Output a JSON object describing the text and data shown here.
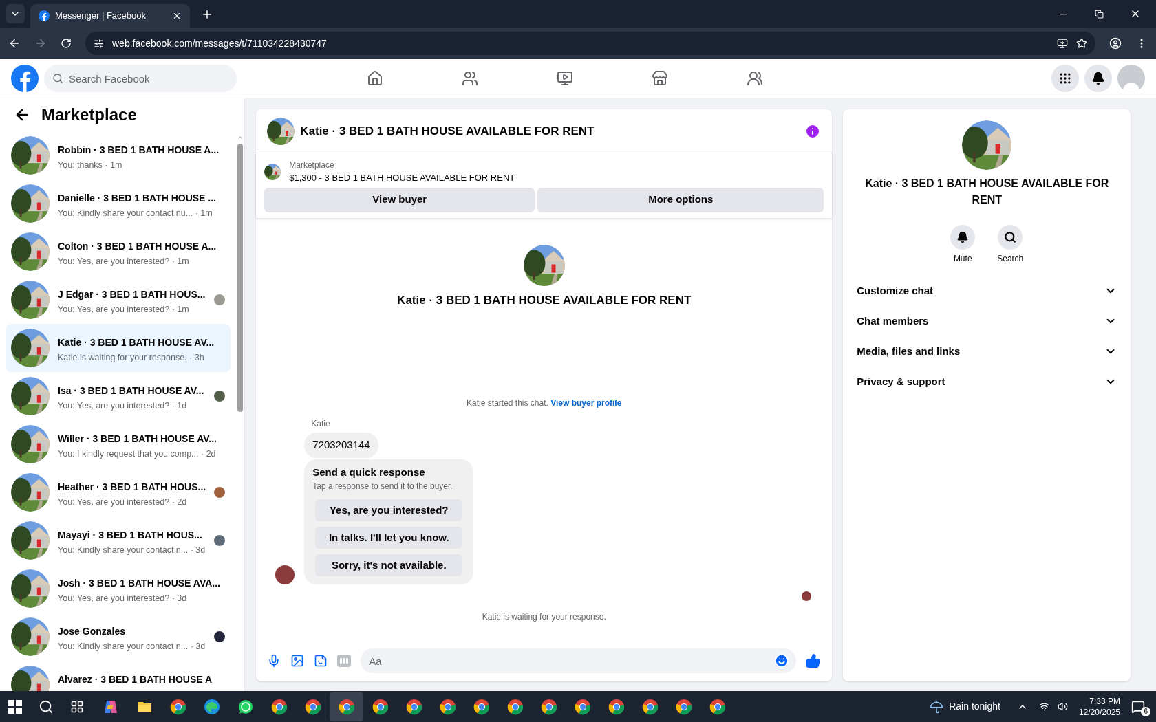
{
  "browser": {
    "tab_title": "Messenger | Facebook",
    "url": "web.facebook.com/messages/t/711034228430747"
  },
  "topbar": {
    "search_placeholder": "Search Facebook",
    "nav": [
      {
        "kind": "home",
        "selected": false
      },
      {
        "kind": "friends",
        "selected": false
      },
      {
        "kind": "video",
        "selected": false
      },
      {
        "kind": "marketplace",
        "selected": false
      },
      {
        "kind": "groups",
        "selected": false
      }
    ]
  },
  "sidebar": {
    "title": "Marketplace",
    "conversations": [
      {
        "name": "Robbin · 3 BED 1 BATH HOUSE A...",
        "preview": "You: thanks · 1m",
        "selected": false
      },
      {
        "name": "Danielle · 3 BED 1 BATH HOUSE ...",
        "preview": "You: Kindly share your contact nu...  · 1m",
        "selected": false
      },
      {
        "name": "Colton · 3 BED 1 BATH HOUSE A...",
        "preview": "You: Yes, are you interested? · 1m",
        "selected": false
      },
      {
        "name": "J Edgar · 3 BED 1 BATH HOUS...",
        "preview": "You: Yes, are you interested? · 1m",
        "selected": false,
        "color": "#9a9a92"
      },
      {
        "name": "Katie · 3 BED 1 BATH HOUSE AV...",
        "preview": "Katie is waiting for your response. · 3h",
        "selected": true
      },
      {
        "name": "Isa · 3 BED 1 BATH HOUSE AV...",
        "preview": "You: Yes, are you interested? · 1d",
        "selected": false,
        "color": "#55604a"
      },
      {
        "name": "Willer · 3 BED 1 BATH HOUSE AV...",
        "preview": "You: I kindly request that you comp... · 2d",
        "selected": false
      },
      {
        "name": "Heather · 3 BED 1 BATH HOUS...",
        "preview": "You: Yes, are you interested? · 2d",
        "selected": false,
        "color": "#a0613f"
      },
      {
        "name": "Mayayi · 3 BED 1 BATH HOUS...",
        "preview": "You: Kindly share your contact n... · 3d",
        "selected": false,
        "color": "#5d6a78"
      },
      {
        "name": "Josh · 3 BED 1 BATH HOUSE AVA...",
        "preview": "You: Yes, are you interested? · 3d",
        "selected": false
      },
      {
        "name": "Jose Gonzales",
        "preview": "You: Kindly share your contact n... · 3d",
        "selected": false,
        "color": "#23263a"
      },
      {
        "name": "Alvarez · 3 BED 1 BATH HOUSE A",
        "selected": false
      }
    ]
  },
  "chat": {
    "title": "Katie · 3 BED 1 BATH HOUSE AVAILABLE FOR RENT",
    "listing_label": "Marketplace",
    "listing": "$1,300 - 3 BED 1 BATH HOUSE AVAILABLE FOR RENT",
    "buttons": [
      "View buyer",
      "More options"
    ],
    "intro_title": "Katie · 3 BED 1 BATH HOUSE AVAILABLE FOR RENT",
    "started": "Katie started this chat.",
    "profile_link": "View buyer profile",
    "sender": "Katie",
    "message": "7203203144",
    "quick": {
      "title": "Send a quick response",
      "subtitle": "Tap a response to send it to the buyer.",
      "options": [
        "Yes, are you interested?",
        "In talks. I'll let you know.",
        "Sorry, it's not available."
      ]
    },
    "waiting": "Katie is waiting for your response.",
    "composer_placeholder": "Aa"
  },
  "details": {
    "title": "Katie · 3 BED 1 BATH HOUSE AVAILABLE FOR RENT",
    "actions": [
      {
        "kind": "mute",
        "label": "Mute"
      },
      {
        "kind": "search",
        "label": "Search"
      }
    ],
    "sections": [
      {
        "label": "Customize chat",
        "expanded": false
      },
      {
        "label": "Chat members",
        "expanded": false
      },
      {
        "label": "Media, files and links",
        "expanded": false
      },
      {
        "label": "Privacy & support",
        "expanded": false
      }
    ]
  },
  "taskbar": {
    "apps": [
      {
        "kind": "copilot",
        "selected": false
      },
      {
        "kind": "explorer",
        "selected": false
      },
      {
        "kind": "chrome",
        "selected": false
      },
      {
        "kind": "edge",
        "selected": false
      },
      {
        "kind": "whatsapp",
        "selected": false
      },
      {
        "kind": "chrome",
        "selected": false
      },
      {
        "kind": "chrome",
        "selected": false
      },
      {
        "kind": "chrome",
        "selected": true
      },
      {
        "kind": "chrome",
        "selected": false
      },
      {
        "kind": "chrome",
        "selected": false
      },
      {
        "kind": "chrome",
        "selected": false
      },
      {
        "kind": "chrome",
        "selected": false
      },
      {
        "kind": "chrome",
        "selected": false
      },
      {
        "kind": "chrome",
        "selected": false
      },
      {
        "kind": "chrome",
        "selected": false
      },
      {
        "kind": "chrome",
        "selected": false
      },
      {
        "kind": "chrome",
        "selected": false
      },
      {
        "kind": "chrome",
        "selected": false
      },
      {
        "kind": "chrome",
        "selected": false
      }
    ],
    "weather": "Rain tonight",
    "time": "7:33 PM",
    "date": "12/20/2025",
    "notifications": "6"
  }
}
